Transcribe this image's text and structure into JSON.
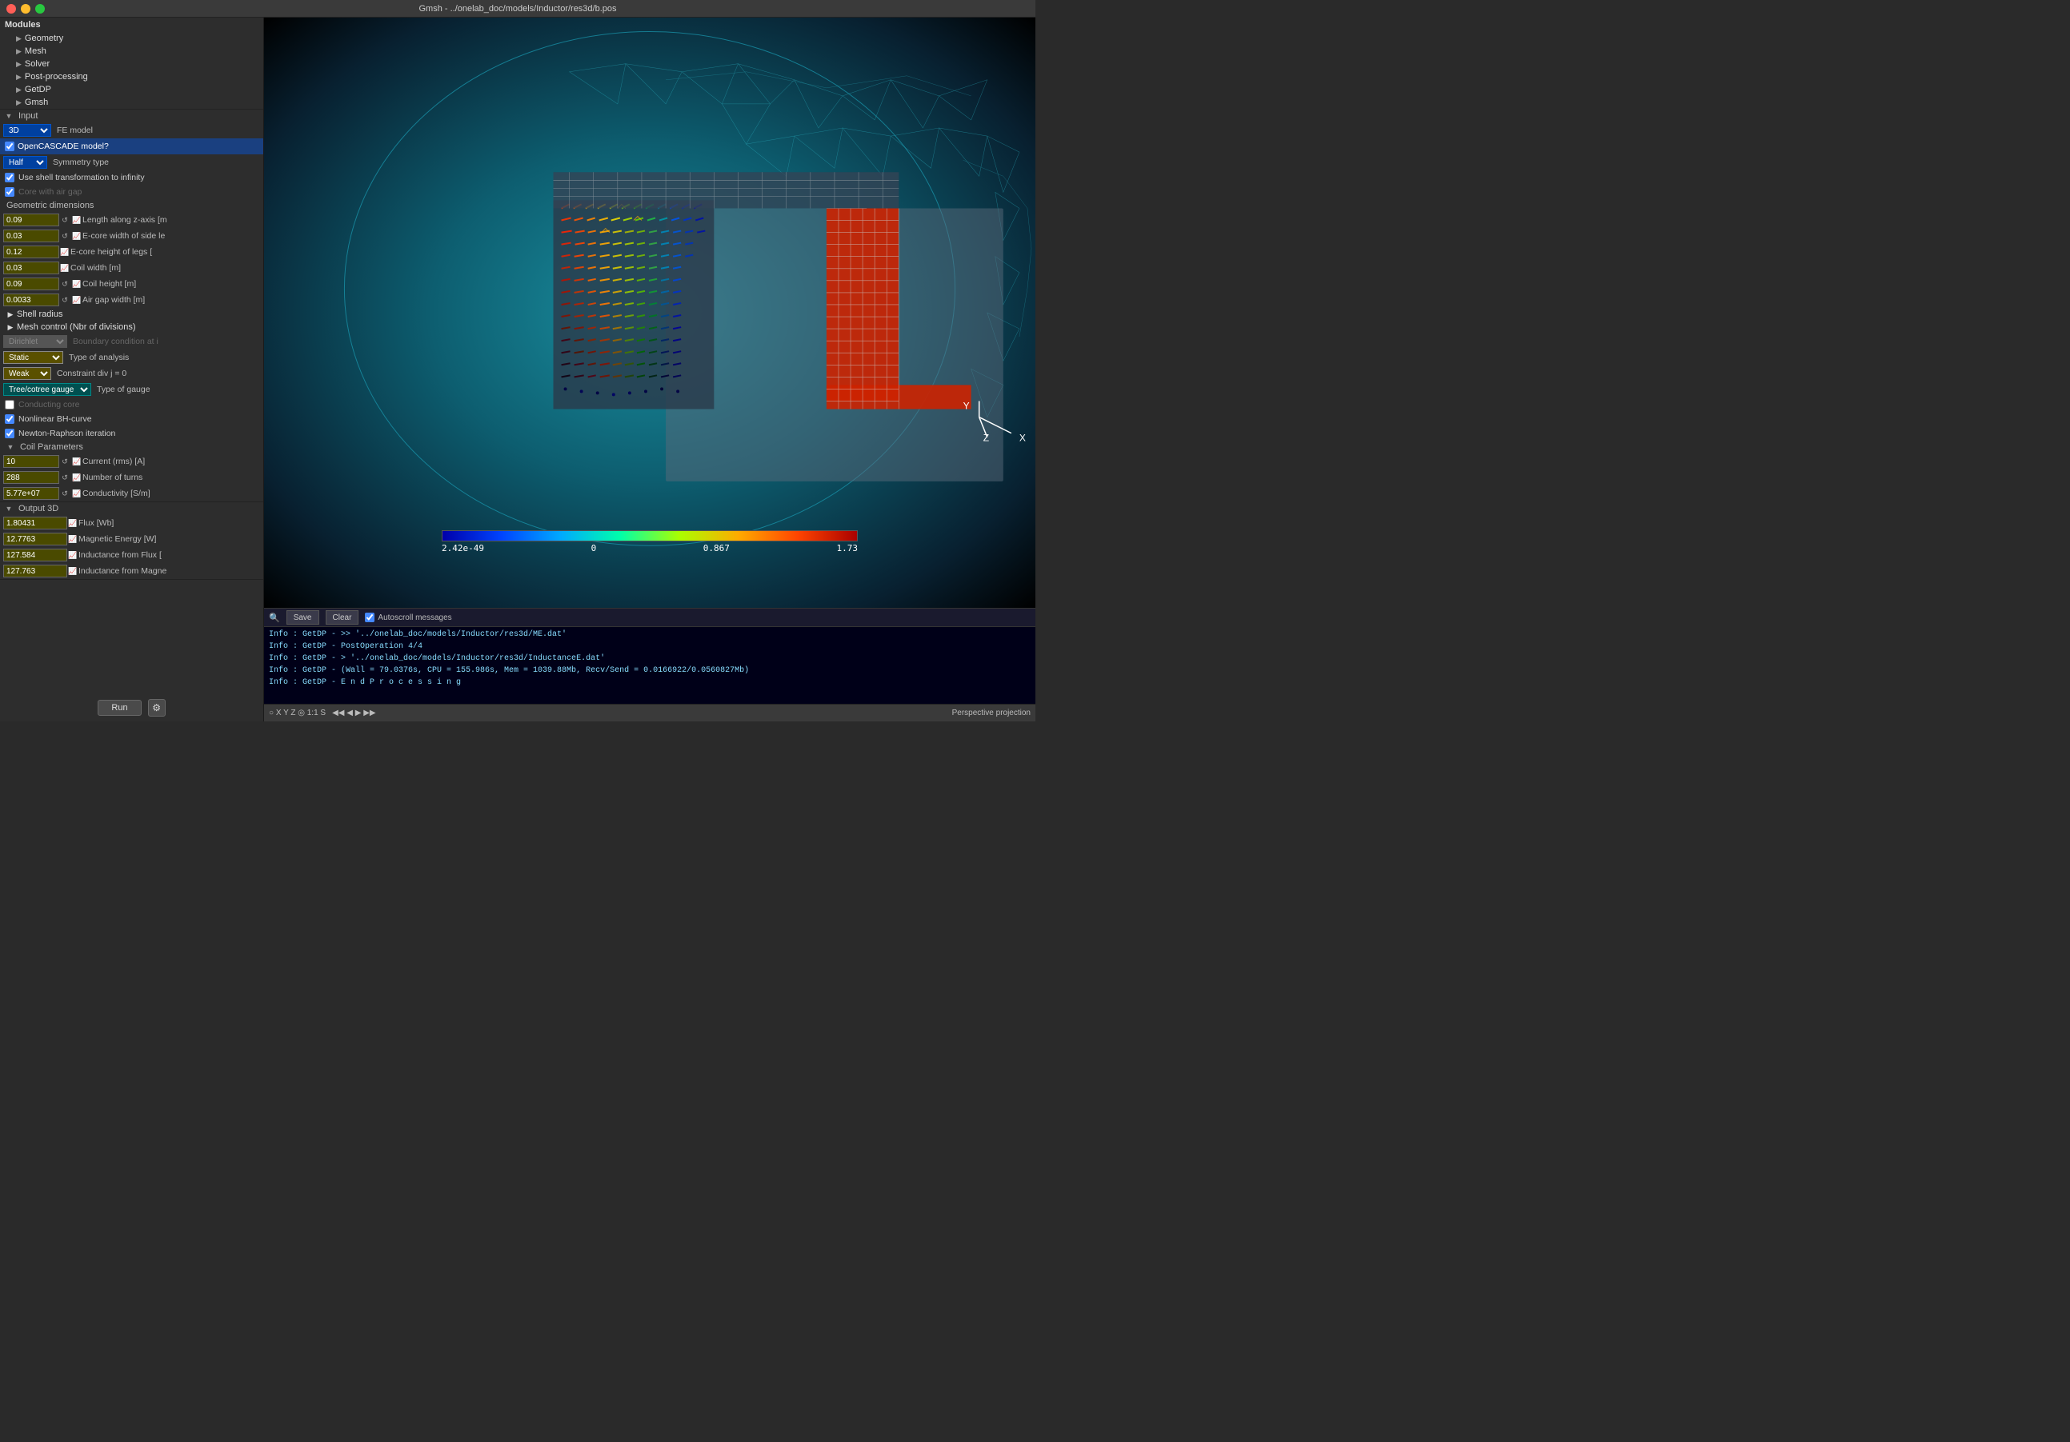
{
  "window": {
    "title": "Gmsh - ../onelab_doc/models/Inductor/res3d/b.pos"
  },
  "modules": {
    "title": "Modules",
    "items": [
      "Geometry",
      "Mesh",
      "Solver",
      "Post-processing"
    ]
  },
  "getdp": {
    "label": "GetDP"
  },
  "gmsh": {
    "label": "Gmsh"
  },
  "input_section": {
    "label": "Input",
    "fe_model_label": "FE model",
    "fe_model_value": "3D",
    "opencascade_label": "OpenCASCADE model?",
    "half_label": "Half",
    "symmetry_type_label": "Symmetry type",
    "shell_transform_label": "Use shell transformation to infinity",
    "core_air_gap_label": "Core with air gap",
    "geo_dimensions_label": "Geometric dimensions",
    "fields": [
      {
        "value": "0.09",
        "label": "Length along z-axis [m",
        "has_arrows": true
      },
      {
        "value": "0.03",
        "label": "E-core width of side le",
        "has_arrows": true
      },
      {
        "value": "0.12",
        "label": "E-core height of legs [",
        "has_arrows": false
      },
      {
        "value": "0.03",
        "label": "Coil width [m]",
        "has_arrows": false
      },
      {
        "value": "0.09",
        "label": "Coil height [m]",
        "has_arrows": true
      },
      {
        "value": "0.0033",
        "label": "Air gap width [m]",
        "has_arrows": true
      }
    ],
    "shell_radius_label": "Shell radius",
    "mesh_control_label": "Mesh control (Nbr of divisions)",
    "boundary_label": "Boundary condition at i",
    "bc_value": "Dirichlet",
    "type_analysis_label": "Type of analysis",
    "type_analysis_value": "Static",
    "constraint_label": "Constraint div j = 0",
    "constraint_value": "Weak",
    "gauge_label": "Type of gauge",
    "gauge_value": "Tree/cotree gauge",
    "conducting_core_label": "Conducting core",
    "nonlinear_bh_label": "Nonlinear BH-curve",
    "newton_label": "Newton-Raphson iteration",
    "coil_params_label": "Coil Parameters",
    "coil_fields": [
      {
        "value": "10",
        "label": "Current (rms) [A]",
        "has_arrows": true
      },
      {
        "value": "288",
        "label": "Number of turns",
        "has_arrows": true
      },
      {
        "value": "5.77e+07",
        "label": "Conductivity [S/m]",
        "has_arrows": true
      }
    ]
  },
  "output_section": {
    "label": "Output 3D",
    "fields": [
      {
        "value": "1.80431",
        "label": "Flux [Wb]"
      },
      {
        "value": "12.7763",
        "label": "Magnetic Energy [W]"
      },
      {
        "value": "127.584",
        "label": "Inductance from Flux ["
      },
      {
        "value": "127.763",
        "label": "Inductance from Magne"
      }
    ]
  },
  "run_button": "Run",
  "gear_icon": "⚙",
  "colorbar": {
    "min_label": "2.42e-49",
    "mid_label": "0",
    "mid2_label": "0.867",
    "max_label": "1.73"
  },
  "console": {
    "search_placeholder": "🔍",
    "save_label": "Save",
    "clear_label": "Clear",
    "autoscroll_label": "Autoscroll messages",
    "lines": [
      {
        "text": "Info    : GetDP  -         >> '../onelab_doc/models/Inductor/res3d/ME.dat'"
      },
      {
        "text": "Info    : GetDP  - PostOperation 4/4"
      },
      {
        "text": "Info    : GetDP  -           > '../onelab_doc/models/Inductor/res3d/InductanceE.dat'"
      },
      {
        "text": "Info    : GetDP  - (Wall = 79.0376s, CPU = 155.986s, Mem = 1039.88Mb, Recv/Send = 0.0166922/0.0560827Mb)"
      },
      {
        "text": "Info    : GetDP  - E n d   P r o c e s s i n g"
      }
    ]
  },
  "statusbar": {
    "coordinates": "○ X Y Z  ◎ 1:1 S",
    "nav_controls": "◀◀ ◀ ▶ ▶▶",
    "projection": "Perspective projection"
  }
}
